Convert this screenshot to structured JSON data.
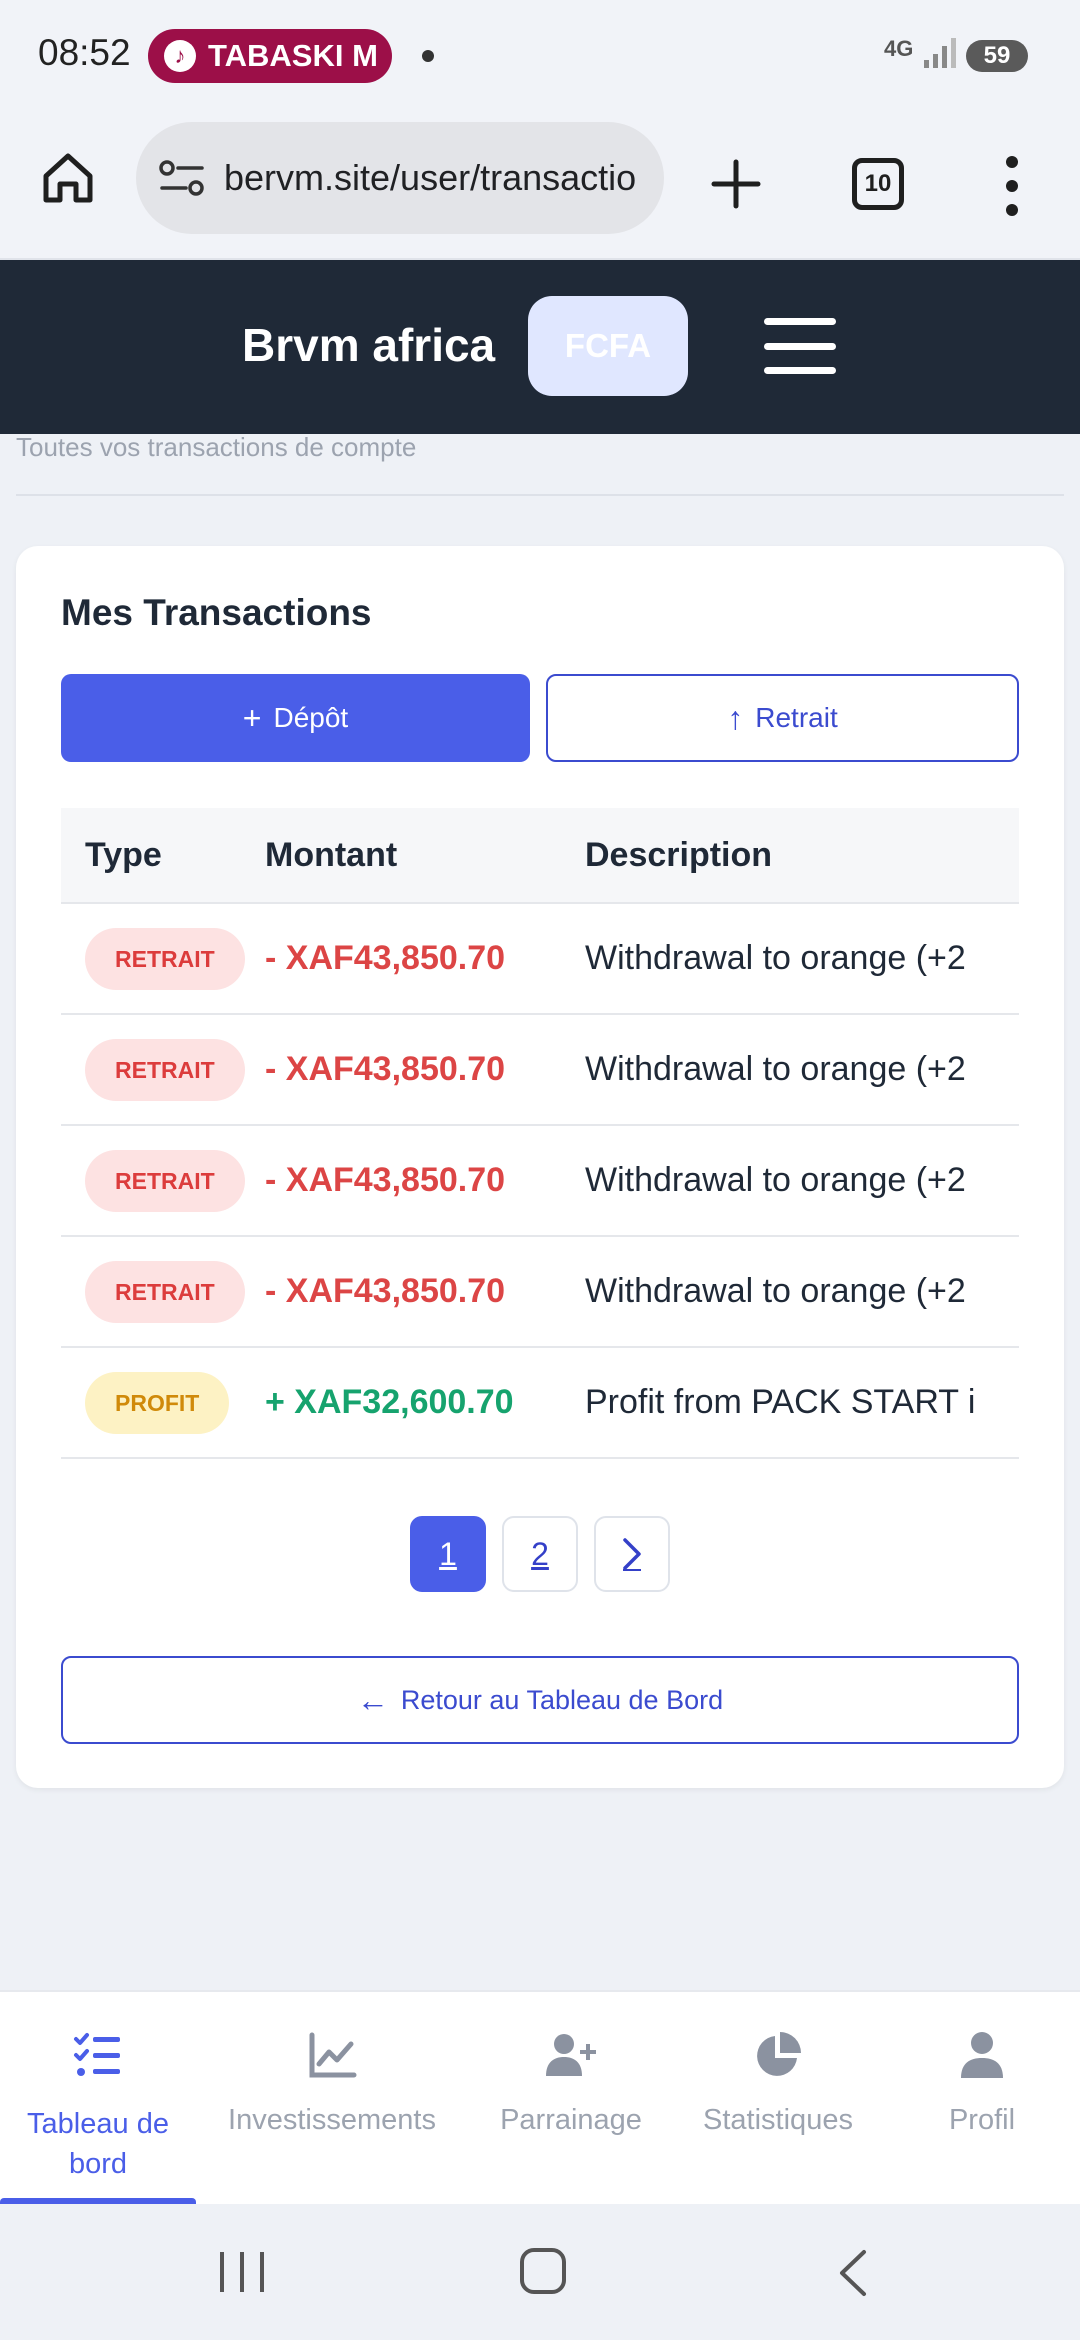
{
  "status_bar": {
    "time": "08:52",
    "notification_label": "TABASKI M",
    "network": "4G",
    "battery": "59"
  },
  "browser": {
    "url": "bervm.site/user/transactio",
    "tab_count": "10"
  },
  "header": {
    "brand": "Brvm africa",
    "currency_button": "FCFA"
  },
  "page": {
    "subtitle": "Toutes vos transactions de compte"
  },
  "transactions": {
    "title": "Mes Transactions",
    "deposit_label": "Dépôt",
    "withdraw_label": "Retrait",
    "columns": [
      "Type",
      "Montant",
      "Description"
    ],
    "rows": [
      {
        "type": "RETRAIT",
        "amount": "- XAF43,850.70",
        "description": "Withdrawal to orange (+2"
      },
      {
        "type": "RETRAIT",
        "amount": "- XAF43,850.70",
        "description": "Withdrawal to orange (+2"
      },
      {
        "type": "RETRAIT",
        "amount": "- XAF43,850.70",
        "description": "Withdrawal to orange (+2"
      },
      {
        "type": "RETRAIT",
        "amount": "- XAF43,850.70",
        "description": "Withdrawal to orange (+2"
      },
      {
        "type": "PROFIT",
        "amount": "+ XAF32,600.70",
        "description": "Profit from PACK START i"
      }
    ],
    "pagination": [
      "1",
      "2"
    ],
    "back_label": "Retour au Tableau de Bord"
  },
  "bottom_nav": {
    "items": [
      {
        "label": "Tableau de bord",
        "icon": "list-check-icon",
        "active": true
      },
      {
        "label": "Investissements",
        "icon": "chart-line-icon",
        "active": false
      },
      {
        "label": "Parrainage",
        "icon": "user-plus-icon",
        "active": false
      },
      {
        "label": "Statistiques",
        "icon": "pie-chart-icon",
        "active": false
      },
      {
        "label": "Profil",
        "icon": "user-icon",
        "active": false
      }
    ]
  },
  "colors": {
    "accent": "#4a5ee8",
    "header_bg": "#1f2937",
    "negative": "#dc4545",
    "positive": "#16a36e"
  }
}
